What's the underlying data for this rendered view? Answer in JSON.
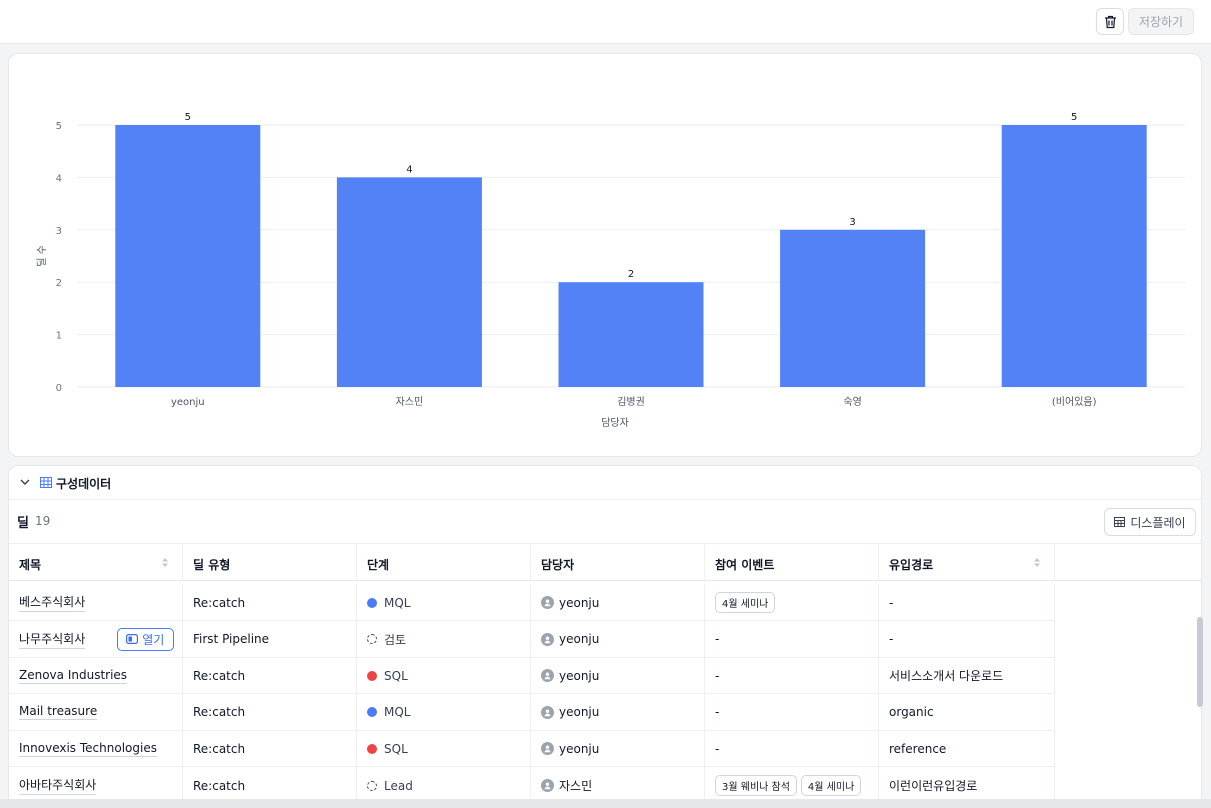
{
  "toolbar": {
    "save_label": "저장하기",
    "delete_icon": "trash-icon"
  },
  "chart_data": {
    "type": "bar",
    "categories": [
      "yeonju",
      "자스민",
      "김병권",
      "숙영",
      "(비어있음)"
    ],
    "values": [
      5,
      4,
      2,
      3,
      5
    ],
    "xlabel": "담당자",
    "ylabel": "딜 수",
    "ylim": [
      0,
      5
    ],
    "yticks": [
      0,
      1,
      2,
      3,
      4,
      5
    ],
    "bar_color": "#5382f6",
    "data_labels": true,
    "grid": true
  },
  "section": {
    "title": "구성데이터",
    "collapse_icon": "chevron-down-icon",
    "grid_icon": "table-icon"
  },
  "deals": {
    "label": "딜",
    "count": "19",
    "display_button": "디스플레이"
  },
  "table": {
    "columns": [
      "제목",
      "딜 유형",
      "단계",
      "담당자",
      "참여 이벤트",
      "유입경로"
    ],
    "open_label": "열기",
    "rows": [
      {
        "title": "베스주식회사",
        "type": "Re:catch",
        "stage": "MQL",
        "stage_color": "#4b7bf5",
        "owner": "yeonju",
        "events": [
          "4월 세미나"
        ],
        "source": "-"
      },
      {
        "title": "나무주식회사",
        "type": "First Pipeline",
        "stage": "검토",
        "stage_color": "dashed",
        "owner": "yeonju",
        "events": [],
        "events_text": "-",
        "source": "-"
      },
      {
        "title": "Zenova Industries",
        "type": "Re:catch",
        "stage": "SQL",
        "stage_color": "#ef4444",
        "owner": "yeonju",
        "events": [],
        "events_text": "-",
        "source": "서비스소개서 다운로드"
      },
      {
        "title": "Mail treasure",
        "type": "Re:catch",
        "stage": "MQL",
        "stage_color": "#4b7bf5",
        "owner": "yeonju",
        "events": [],
        "events_text": "-",
        "source": "organic"
      },
      {
        "title": "Innovexis Technologies",
        "type": "Re:catch",
        "stage": "SQL",
        "stage_color": "#ef4444",
        "owner": "yeonju",
        "events": [],
        "events_text": "-",
        "source": "reference"
      },
      {
        "title": "아바타주식회사",
        "type": "Re:catch",
        "stage": "Lead",
        "stage_color": "dashed",
        "owner": "자스민",
        "events": [
          "3월 웨비나 참석",
          "4월 세미나"
        ],
        "source": "이런이런유입경로"
      }
    ]
  }
}
